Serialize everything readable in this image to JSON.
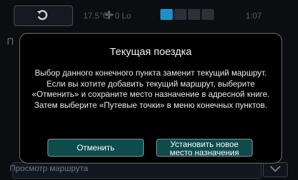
{
  "background": {
    "title": "П",
    "bottom_label": "Просмотр маршрута"
  },
  "status": {
    "temperature": "17.5",
    "temp_suffix": "℃",
    "fan": "0 Lo",
    "clock": "1:07",
    "icons": [
      "back-arrow-icon",
      "fan-icon",
      "screen-icon",
      "mute-icon",
      "phone-icon",
      "bluetooth-icon"
    ]
  },
  "dialog": {
    "title": "Текущая поездка",
    "message": "Выбор данного конечного пункта заменит текущий маршрут. Если вы хотите добавить текущий маршрут, выберите «Отменить» и сохраните место назначение в адресной книге. Затем выберите «Путевые точки» в меню конечных пунктов.",
    "cancel_label": "Отменить",
    "set_label_line1": "Установить новое",
    "set_label_line2": "место назначения"
  },
  "colors": {
    "button_bg": "#0e4c4c",
    "button_border": "#8a949c",
    "status_text": "#585e64",
    "icon_accent": "#1f8fc7"
  }
}
